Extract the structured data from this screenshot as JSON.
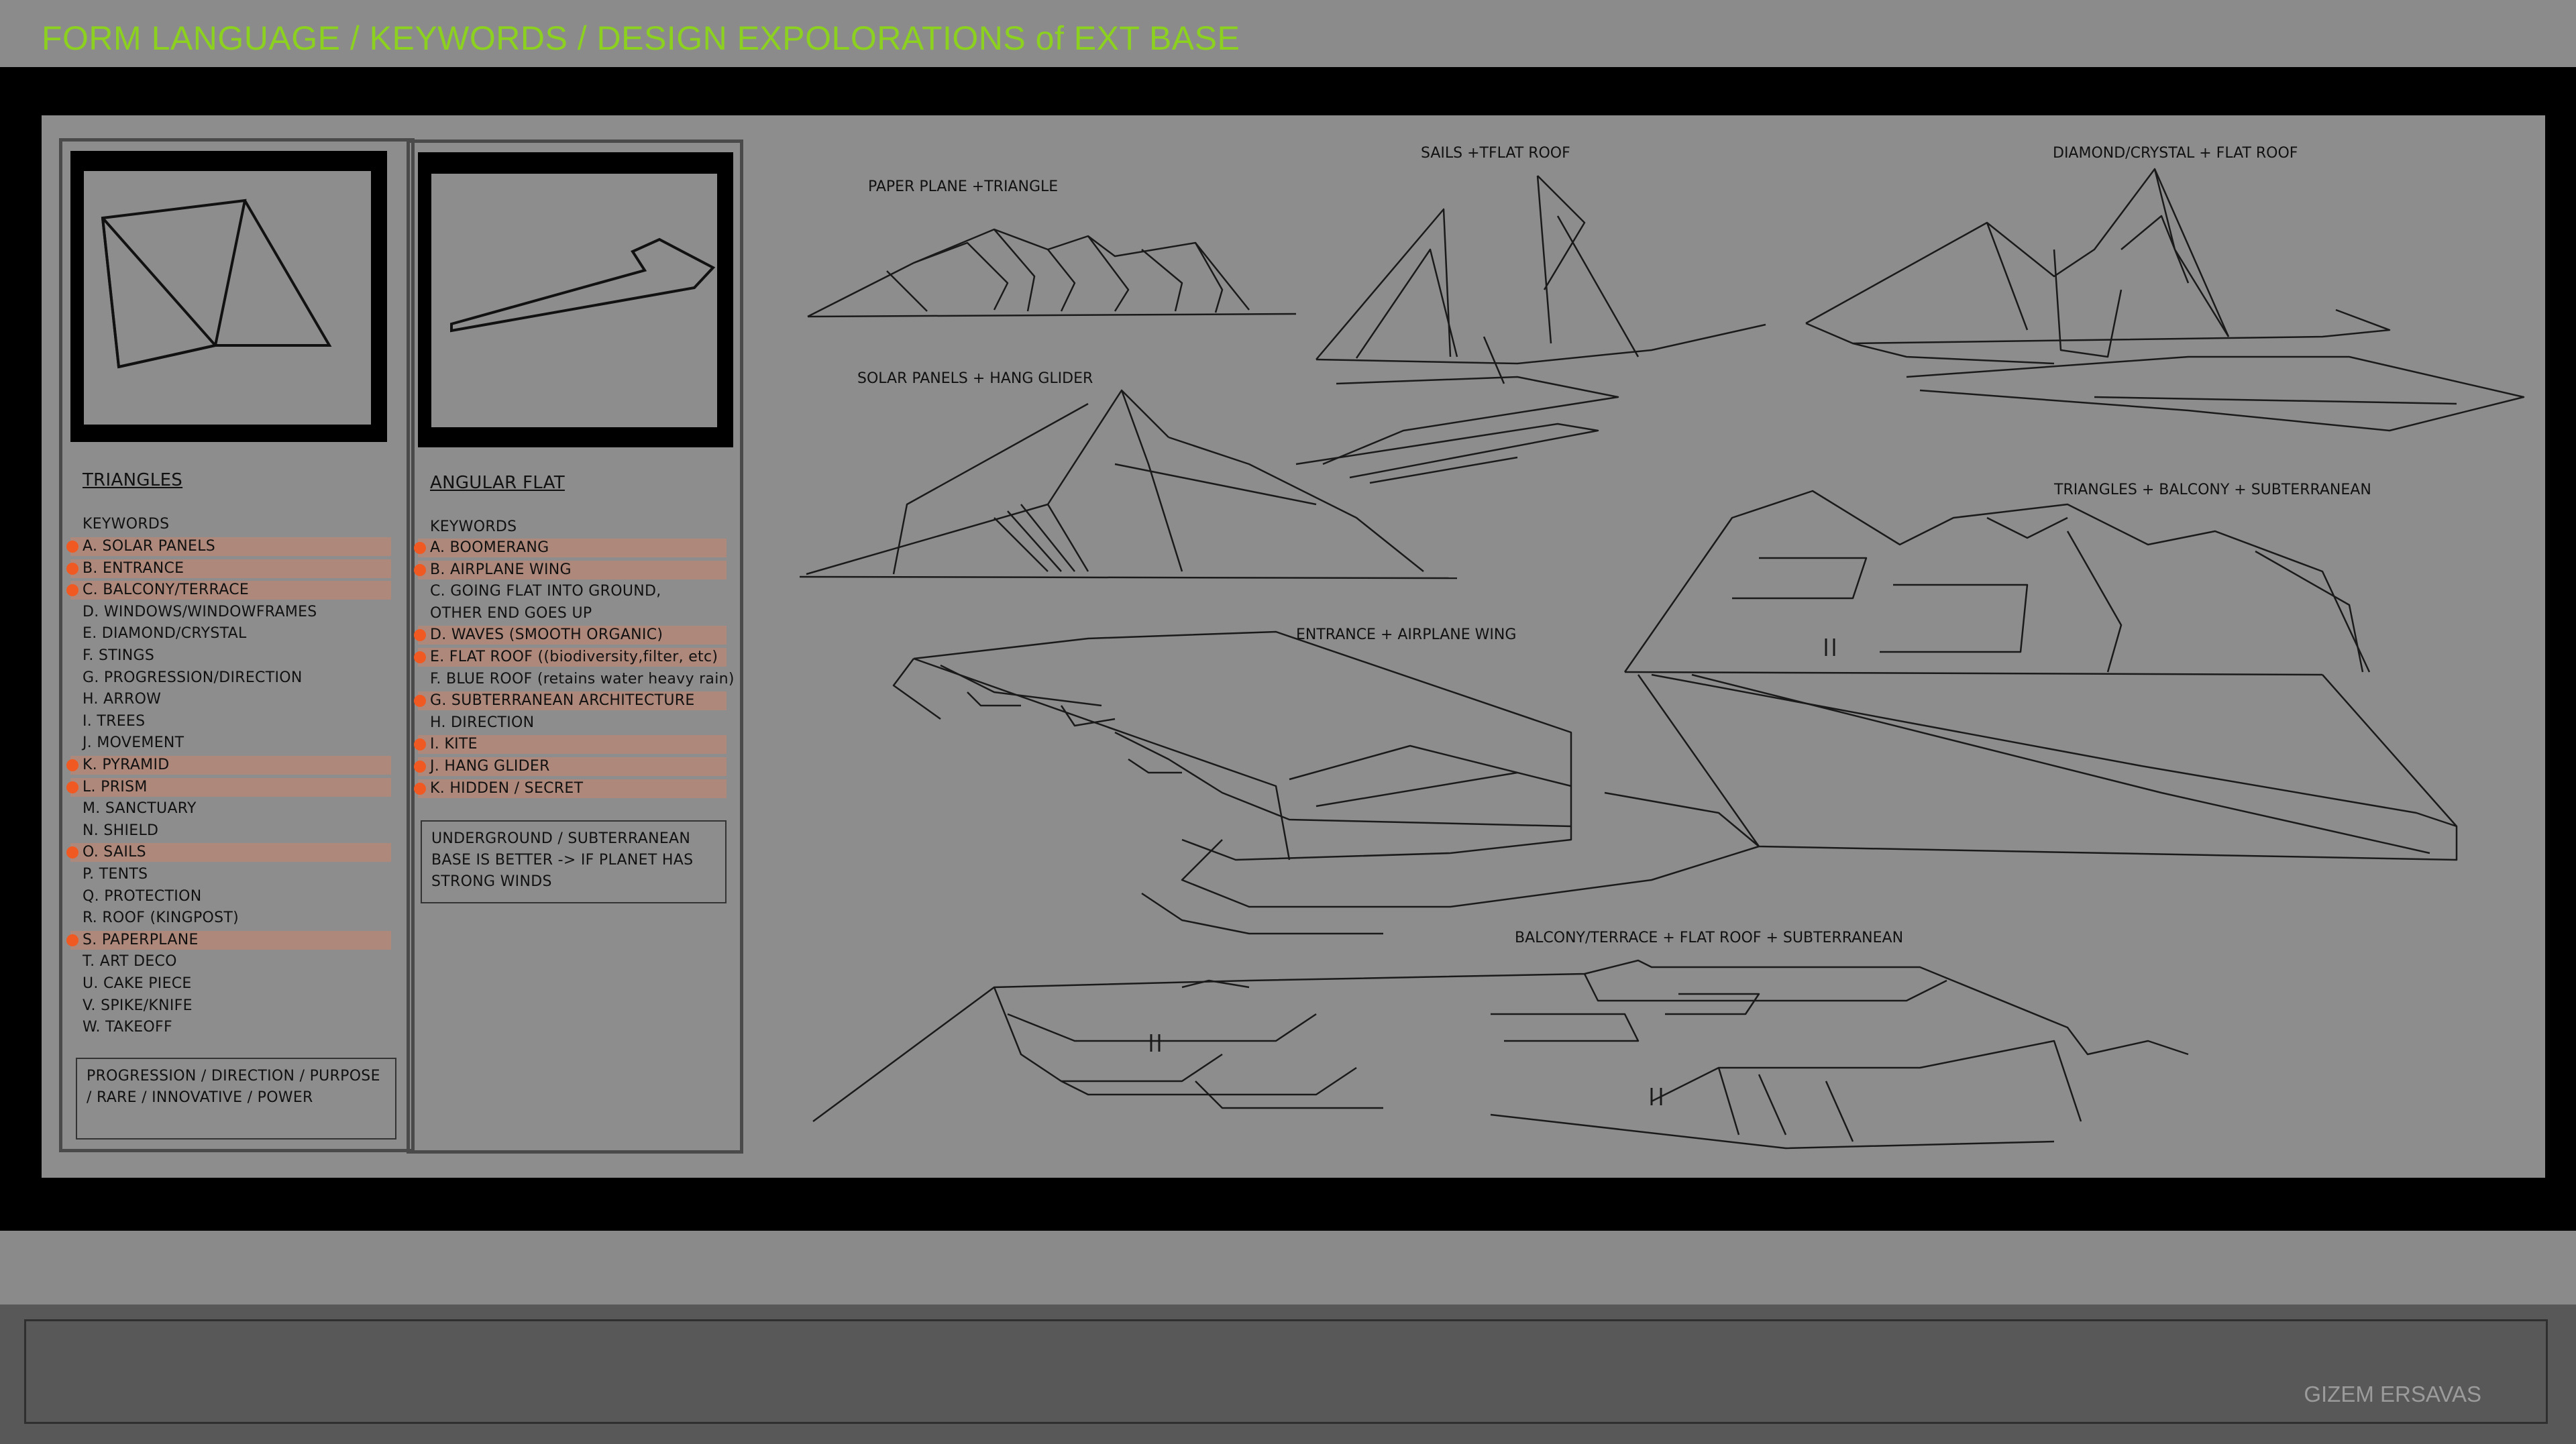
{
  "header": {
    "title": "FORM LANGUAGE / KEYWORDS / DESIGN EXPOLORATIONS of EXT BASE"
  },
  "footer": {
    "author": "GIZEM ERSAVAS"
  },
  "colors": {
    "title": "#8cd11f",
    "highlight_dot": "#f05a22",
    "highlight_band": "#d68264"
  },
  "panels": [
    {
      "heading": "TRIANGLES",
      "keywords_label": "KEYWORDS",
      "keywords": [
        {
          "text": "A. SOLAR PANELS",
          "highlighted": true
        },
        {
          "text": "B. ENTRANCE",
          "highlighted": true
        },
        {
          "text": "C. BALCONY/TERRACE",
          "highlighted": true
        },
        {
          "text": "D. WINDOWS/WINDOWFRAMES",
          "highlighted": false
        },
        {
          "text": "E. DIAMOND/CRYSTAL",
          "highlighted": false
        },
        {
          "text": "F. STINGS",
          "highlighted": false
        },
        {
          "text": "G. PROGRESSION/DIRECTION",
          "highlighted": false
        },
        {
          "text": "H. ARROW",
          "highlighted": false
        },
        {
          "text": "I. TREES",
          "highlighted": false
        },
        {
          "text": "J. MOVEMENT",
          "highlighted": false
        },
        {
          "text": "K. PYRAMID",
          "highlighted": true
        },
        {
          "text": "L. PRISM",
          "highlighted": true
        },
        {
          "text": "M. SANCTUARY",
          "highlighted": false
        },
        {
          "text": "N. SHIELD",
          "highlighted": false
        },
        {
          "text": "O. SAILS",
          "highlighted": true
        },
        {
          "text": "P. TENTS",
          "highlighted": false
        },
        {
          "text": "Q. PROTECTION",
          "highlighted": false
        },
        {
          "text": "R. ROOF (KINGPOST)",
          "highlighted": false
        },
        {
          "text": "S. PAPERPLANE",
          "highlighted": true
        },
        {
          "text": "T. ART DECO",
          "highlighted": false
        },
        {
          "text": "U. CAKE PIECE",
          "highlighted": false
        },
        {
          "text": "V. SPIKE/KNIFE",
          "highlighted": false
        },
        {
          "text": "W. TAKEOFF",
          "highlighted": false
        }
      ],
      "note": "PROGRESSION / DIRECTION / PURPOSE / RARE / INNOVATIVE / POWER"
    },
    {
      "heading": "ANGULAR FLAT",
      "keywords_label": "KEYWORDS",
      "keywords": [
        {
          "text": "A. BOOMERANG",
          "highlighted": true
        },
        {
          "text": "B. AIRPLANE WING",
          "highlighted": true
        },
        {
          "text": "C. GOING FLAT INTO GROUND,",
          "highlighted": false
        },
        {
          "text": "OTHER END GOES UP",
          "highlighted": false
        },
        {
          "text": "D. WAVES (SMOOTH ORGANIC)",
          "highlighted": true
        },
        {
          "text": "E. FLAT ROOF ((biodiversity,filter, etc)",
          "highlighted": true
        },
        {
          "text": "F. BLUE ROOF (retains water heavy rain)",
          "highlighted": false
        },
        {
          "text": "G. SUBTERRANEAN ARCHITECTURE",
          "highlighted": true
        },
        {
          "text": "H. DIRECTION",
          "highlighted": false
        },
        {
          "text": "I. KITE",
          "highlighted": true
        },
        {
          "text": "J. HANG GLIDER",
          "highlighted": true
        },
        {
          "text": "K. HIDDEN / SECRET",
          "highlighted": true
        }
      ],
      "note": "UNDERGROUND / SUBTERRANEAN BASE IS BETTER -> IF PLANET HAS STRONG WINDS"
    }
  ],
  "sketches": [
    {
      "label": "PAPER PLANE +TRIANGLE"
    },
    {
      "label": "SAILS +TFLAT ROOF"
    },
    {
      "label": "DIAMOND/CRYSTAL + FLAT ROOF"
    },
    {
      "label": "SOLAR PANELS + HANG GLIDER"
    },
    {
      "label": "TRIANGLES + BALCONY + SUBTERRANEAN"
    },
    {
      "label": "ENTRANCE + AIRPLANE WING"
    },
    {
      "label": "BALCONY/TERRACE + FLAT ROOF + SUBTERRANEAN"
    }
  ]
}
